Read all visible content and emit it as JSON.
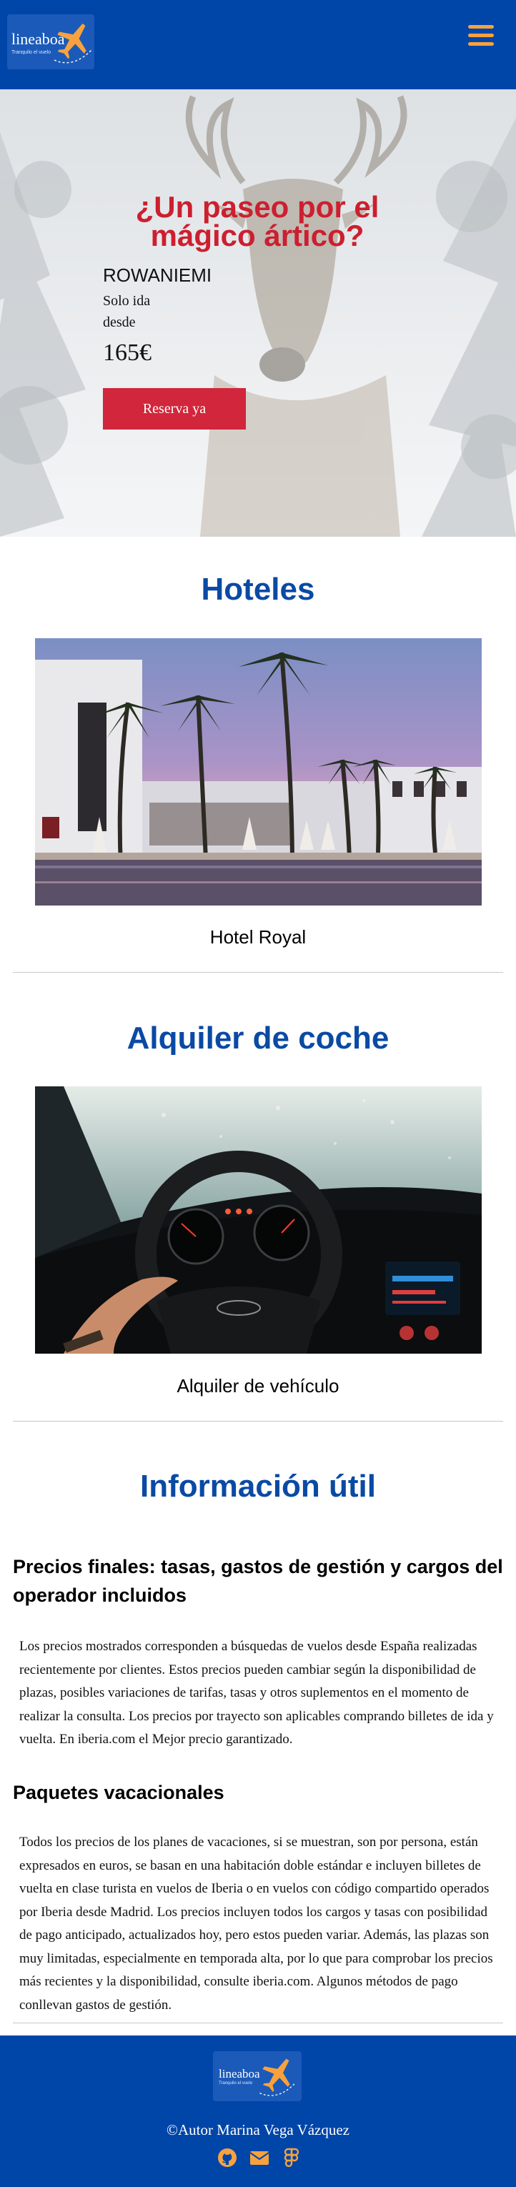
{
  "header": {
    "logo_text": "lineaboa",
    "logo_tagline": "Tranquilo el vuelo",
    "menu_icon": "hamburger-menu-icon"
  },
  "hero": {
    "title": "¿Un paseo por el mágico ártico?",
    "city": "ROWANIEMI",
    "trip_type": "Solo ida",
    "from_label": "desde",
    "price": "165€",
    "button_label": "Reserva ya"
  },
  "hotels": {
    "title": "Hoteles",
    "caption": "Hotel Royal"
  },
  "cars": {
    "title": "Alquiler de coche",
    "caption": "Alquiler de vehículo"
  },
  "info": {
    "title": "Información útil",
    "sections": [
      {
        "heading": "Precios finales: tasas, gastos de gestión y cargos del operador incluidos",
        "text": "Los precios mostrados corresponden a búsquedas de vuelos desde España realizadas recientemente por clientes. Estos precios pueden cambiar según la disponibilidad de plazas, posibles variaciones de tarifas, tasas y otros suplementos en el momento de realizar la consulta. Los precios por trayecto son aplicables comprando billetes de ida y vuelta. En iberia.com el Mejor precio garantizado."
      },
      {
        "heading": "Paquetes vacacionales",
        "text": "Todos los precios de los planes de vacaciones, si se muestran, son por persona, están expresados en euros, se basan en una habitación doble estándar e incluyen billetes de vuelta en clase turista en vuelos de Iberia o en vuelos con código compartido operados por Iberia desde Madrid. Los precios incluyen todos los cargos y tasas con posibilidad de pago anticipado, actualizados hoy, pero estos pueden variar. Además, las plazas son muy limitadas, especialmente en temporada alta, por lo que para comprobar los precios más recientes y la disponibilidad, consulte iberia.com. Algunos métodos de pago conllevan gastos de gestión."
      }
    ]
  },
  "footer": {
    "logo_text": "lineaboa",
    "logo_tagline": "Tranquilo el vuelo",
    "copyright": "©Autor Marina Vega Vázquez",
    "social_icons": [
      "github-icon",
      "envelope-icon",
      "figma-icon"
    ]
  },
  "colors": {
    "primary": "#0045a8",
    "accent": "#f7a23e",
    "cta": "#d1263b",
    "heading_blue": "#0a4aa4",
    "hero_title": "#cc1f2f"
  }
}
